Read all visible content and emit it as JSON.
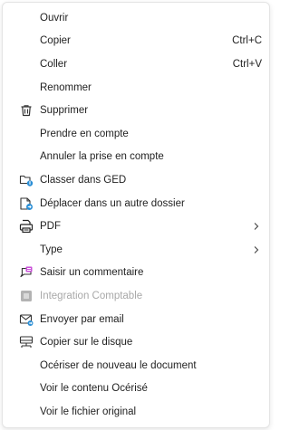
{
  "menu": {
    "items": [
      {
        "label": "Ouvrir"
      },
      {
        "label": "Copier",
        "shortcut": "Ctrl+C"
      },
      {
        "label": "Coller",
        "shortcut": "Ctrl+V"
      },
      {
        "label": "Renommer"
      },
      {
        "label": "Supprimer",
        "icon": "trash-icon"
      },
      {
        "label": "Prendre en compte"
      },
      {
        "label": "Annuler la prise en compte"
      },
      {
        "label": "Classer dans GED",
        "icon": "folder-ged-icon"
      },
      {
        "label": "Déplacer dans un autre dossier",
        "icon": "move-document-icon"
      },
      {
        "label": "PDF",
        "icon": "pdf-print-icon",
        "submenu": true
      },
      {
        "label": "Type",
        "submenu": true
      },
      {
        "label": "Saisir un commentaire",
        "icon": "comment-icon"
      },
      {
        "label": "Integration Comptable",
        "icon": "accounting-icon",
        "disabled": true
      },
      {
        "label": "Envoyer par email",
        "icon": "email-icon"
      },
      {
        "label": "Copier sur le disque",
        "icon": "disk-copy-icon"
      },
      {
        "label": "Océriser de nouveau le document"
      },
      {
        "label": "Voir le contenu Océrisé"
      },
      {
        "label": "Voir le fichier original"
      }
    ]
  },
  "colors": {
    "accent": "#2b8fd6",
    "comment_accent": "#c94fd8",
    "disabled_text": "#a8a8a8",
    "text": "#1f1f1f"
  }
}
